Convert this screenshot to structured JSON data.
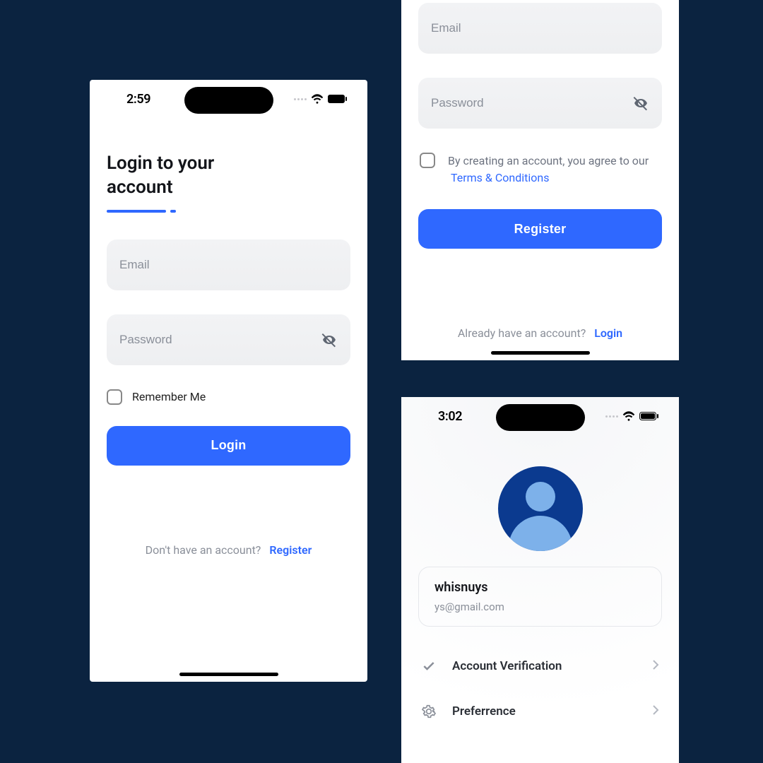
{
  "colors": {
    "primary": "#2f68ff",
    "background": "#0b2340"
  },
  "login": {
    "status_time": "2:59",
    "title": "Login to your account",
    "email_placeholder": "Email",
    "password_placeholder": "Password",
    "remember_label": "Remember Me",
    "login_button": "Login",
    "no_account_text": "Don't have an account?",
    "register_link": "Register"
  },
  "register": {
    "email_placeholder": "Email",
    "password_placeholder": "Password",
    "agree_text": "By creating an account, you agree to our",
    "terms_link": "Terms & Conditions",
    "register_button": "Register",
    "already_text": "Already have an account?",
    "login_link": "Login"
  },
  "profile": {
    "status_time": "3:02",
    "username": "whisnuys",
    "email": "ys@gmail.com",
    "rows": [
      {
        "label": "Account Verification"
      },
      {
        "label": "Preferrence"
      }
    ]
  }
}
